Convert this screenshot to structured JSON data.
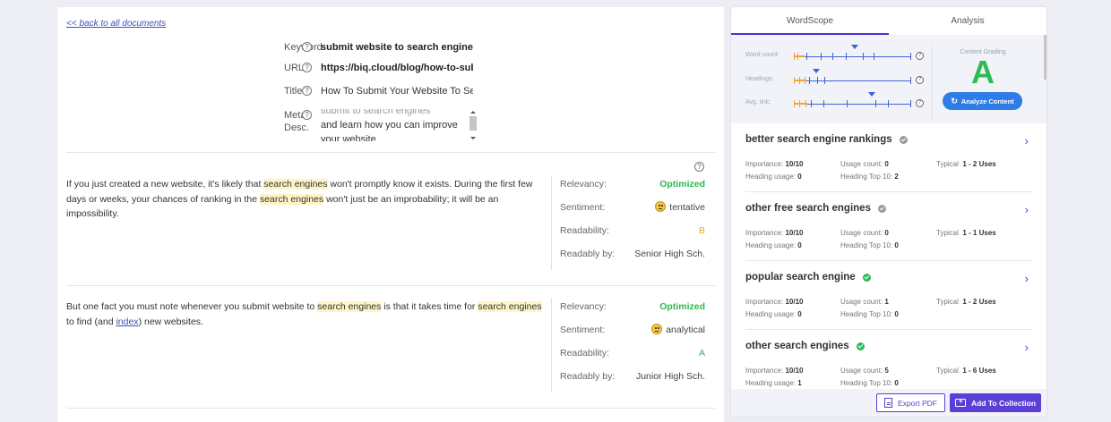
{
  "document": {
    "back_link": "<< back to all documents",
    "meta": {
      "keyword": {
        "label": "Keyword",
        "value": "submit website to search engines"
      },
      "url": {
        "label": "URL",
        "value": "https://biq.cloud/blog/how-to-submit-website"
      },
      "title": {
        "label": "Title",
        "value": "How To Submit Your Website To Search Engines"
      },
      "description": {
        "label_line1": "Meta",
        "label_line2": "Desc.",
        "line_partial": "submit to search engines",
        "line1": "and learn how you can improve",
        "line2": "your website"
      }
    },
    "help_glyph": "?",
    "paragraphs": [
      {
        "segments": [
          {
            "text": "If you just created a new website, it's likely that "
          },
          {
            "text": "search engines",
            "hl": true
          },
          {
            "text": " won't promptly know it exists. During the first few days or weeks, your chances of ranking in the "
          },
          {
            "text": "search engines",
            "hl": true
          },
          {
            "text": " won't just be an improbability; it will be an impossibility."
          }
        ],
        "stats": {
          "relevancy_label": "Relevancy:",
          "relevancy_value": "Optimized",
          "sentiment_label": "Sentiment:",
          "sentiment_value": "tentative",
          "readability_label": "Readability:",
          "readability_value": "B",
          "readably_label": "Readably by:",
          "readably_value": "Senior High Sch."
        }
      },
      {
        "segments": [
          {
            "text": "But one fact you must note whenever you submit website to "
          },
          {
            "text": "search engines",
            "hl": true
          },
          {
            "text": " is that it takes time for "
          },
          {
            "text": "search engines",
            "hl": true
          },
          {
            "text": " to find (and "
          },
          {
            "text": "index",
            "link": true
          },
          {
            "text": ") new websites."
          }
        ],
        "stats": {
          "relevancy_label": "Relevancy:",
          "relevancy_value": "Optimized",
          "sentiment_label": "Sentiment:",
          "sentiment_value": "analytical",
          "readability_label": "Readability:",
          "readability_value": "A",
          "readably_label": "Readably by:",
          "readably_value": "Junior High Sch."
        }
      }
    ]
  },
  "panel": {
    "tabs": [
      "WordScope",
      "Analysis"
    ],
    "active_tab": 0,
    "sliders": [
      {
        "label": "Word count:"
      },
      {
        "label": "Headings:"
      },
      {
        "label": "Avg. link:"
      }
    ],
    "grading": {
      "title": "Content Grading",
      "grade": "A",
      "button": "Analyze Content"
    },
    "keywords": [
      {
        "title": "better search engine rankings",
        "status": "grey",
        "importance_label": "Importance:",
        "importance": "10/10",
        "usage_label": "Usage count:",
        "usage": "0",
        "typical_label": "Typical",
        "typical": "1 - 2 Uses",
        "heading_label": "Heading usage:",
        "heading": "0",
        "top10_label": "Heading Top 10:",
        "top10": "2"
      },
      {
        "title": "other free search engines",
        "status": "grey",
        "importance_label": "Importance:",
        "importance": "10/10",
        "usage_label": "Usage count:",
        "usage": "0",
        "typical_label": "Typical",
        "typical": "1 - 1 Uses",
        "heading_label": "Heading usage:",
        "heading": "0",
        "top10_label": "Heading Top 10:",
        "top10": "0"
      },
      {
        "title": "popular search engine",
        "status": "green",
        "importance_label": "Importance:",
        "importance": "10/10",
        "usage_label": "Usage count:",
        "usage": "1",
        "typical_label": "Typical",
        "typical": "1 - 2 Uses",
        "heading_label": "Heading usage:",
        "heading": "0",
        "top10_label": "Heading Top 10:",
        "top10": "0"
      },
      {
        "title": "other search engines",
        "status": "green",
        "importance_label": "Importance:",
        "importance": "10/10",
        "usage_label": "Usage count:",
        "usage": "5",
        "typical_label": "Typical",
        "typical": "1 - 6 Uses",
        "heading_label": "Heading usage:",
        "heading": "1",
        "top10_label": "Heading Top 10:",
        "top10": "0"
      }
    ],
    "footer": {
      "export": "Export PDF",
      "add": "Add To Collection"
    }
  },
  "colors": {
    "accent": "#5b3fd6",
    "green": "#2dbb55",
    "blue": "#2e7de6",
    "highlight": "#fdf5c4",
    "orange": "#f3a23a"
  }
}
